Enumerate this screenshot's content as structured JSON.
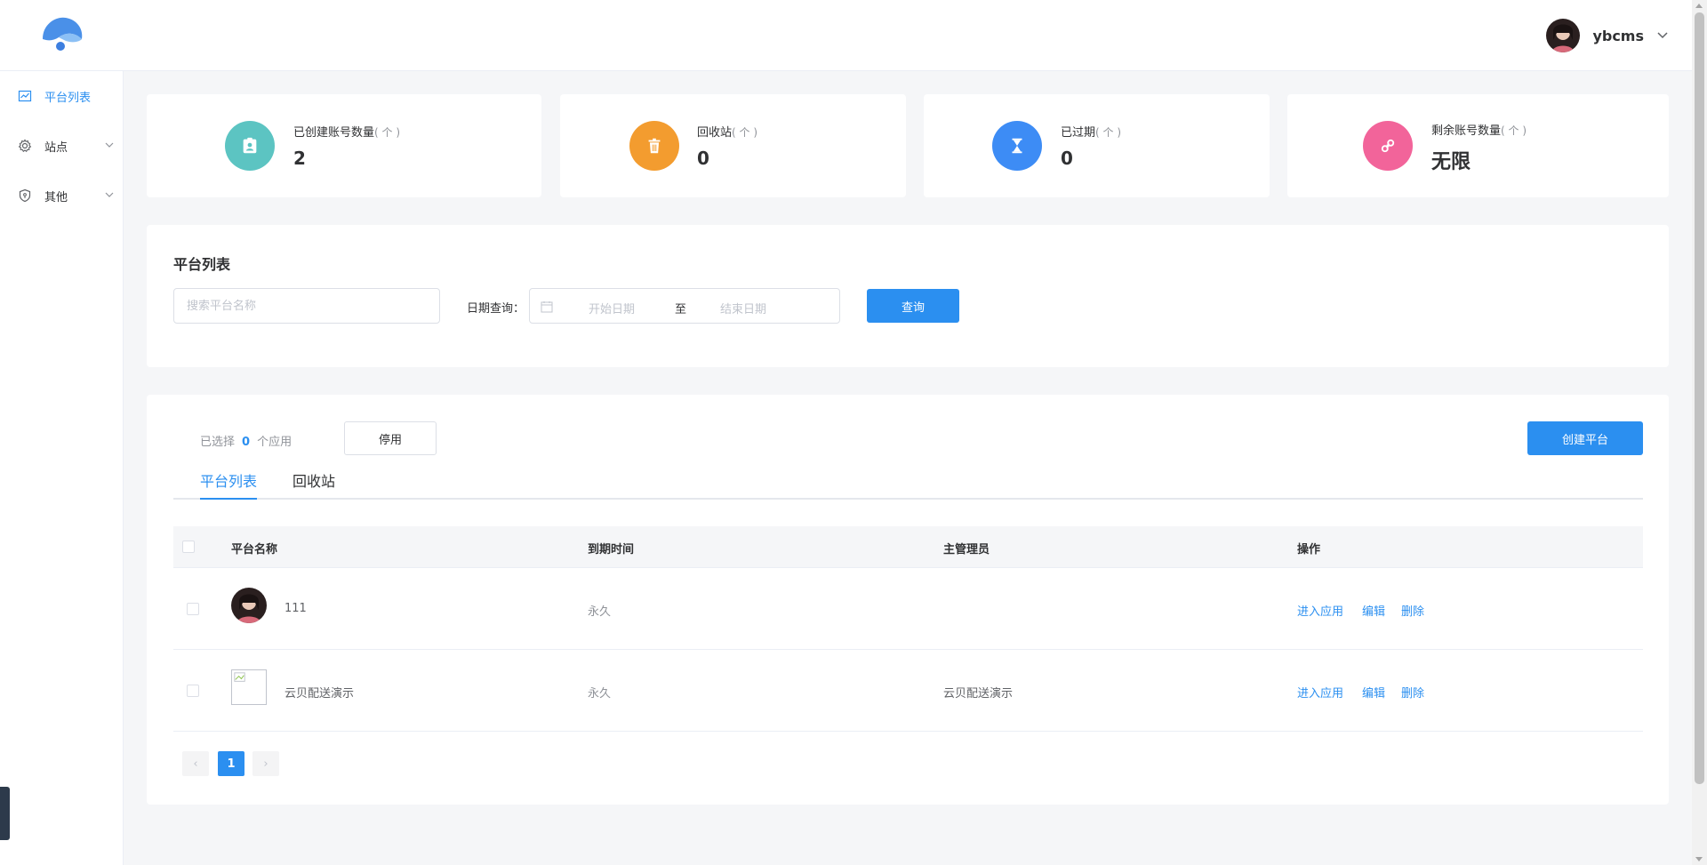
{
  "header": {
    "user_name": "ybcms"
  },
  "sidebar": {
    "items": [
      {
        "label": "平台列表",
        "icon": "chart-line-icon",
        "active": true
      },
      {
        "label": "站点",
        "icon": "gear-icon",
        "active": false
      },
      {
        "label": "其他",
        "icon": "shield-icon",
        "active": false
      }
    ]
  },
  "stats": [
    {
      "label": "已创建账号数量",
      "unit": "( 个 )",
      "value": "2",
      "icon": "id-badge-icon",
      "color": "#5cc4c2"
    },
    {
      "label": "回收站",
      "unit": "( 个 )",
      "value": "0",
      "icon": "trash-icon",
      "color": "#f39c2f"
    },
    {
      "label": "已过期",
      "unit": "( 个 )",
      "value": "0",
      "icon": "hourglass-icon",
      "color": "#3d8cf5"
    },
    {
      "label": "剩余账号数量",
      "unit": "( 个 )",
      "value": "无限",
      "icon": "link-icon",
      "color": "#f2649a"
    }
  ],
  "filter": {
    "title": "平台列表",
    "search_placeholder": "搜索平台名称",
    "date_label": "日期查询：",
    "date_start_placeholder": "开始日期",
    "date_separator": "至",
    "date_end_placeholder": "结束日期",
    "query_button": "查询"
  },
  "list": {
    "selected_prefix": "已选择",
    "selected_count": "0",
    "selected_suffix": "个应用",
    "disable_button": "停用",
    "create_button": "创建平台",
    "tabs": [
      "平台列表",
      "回收站"
    ],
    "columns": [
      "平台名称",
      "到期时间",
      "主管理员",
      "操作"
    ],
    "rows": [
      {
        "name": "111",
        "expire": "永久",
        "admin": "",
        "ops": [
          "进入应用",
          "编辑",
          "删除"
        ]
      },
      {
        "name": "云贝配送演示",
        "expire": "永久",
        "admin": "云贝配送演示",
        "ops": [
          "进入应用",
          "编辑",
          "删除"
        ]
      }
    ],
    "pagination": {
      "prev": "‹",
      "current": "1",
      "next": "›"
    }
  }
}
